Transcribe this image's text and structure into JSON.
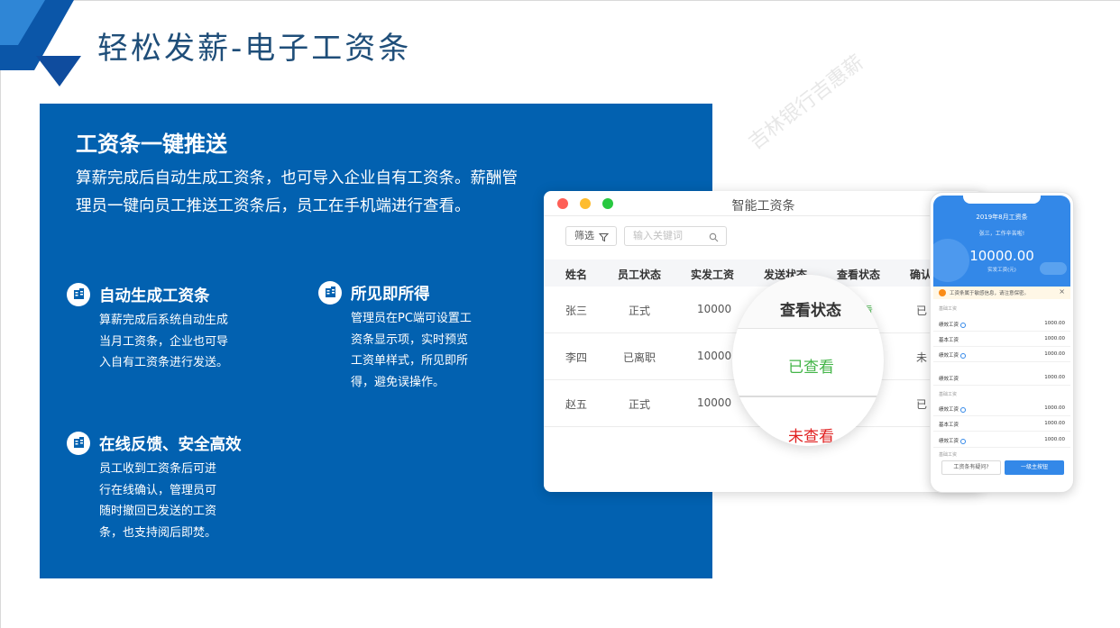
{
  "slide": {
    "title": "轻松发薪-电子工资条"
  },
  "panel": {
    "heading": "工资条一键推送",
    "description": "算薪完成后自动生成工资条，也可导入企业自有工资条。薪酬管理员一键向员工推送工资条后，员工在手机端进行查看。",
    "features": [
      {
        "title": "自动生成工资条",
        "desc": "算薪完成后系统自动生成当月工资条，企业也可导入自有工资条进行发送。",
        "icon": "building-icon"
      },
      {
        "title": "所见即所得",
        "desc": "管理员在PC端可设置工资条显示项，实时预览工资单样式，所见即所得，避免误操作。",
        "icon": "building-icon"
      },
      {
        "title": "在线反馈、安全高效",
        "desc": "员工收到工资条后可进行在线确认，管理员可随时撤回已发送的工资条，也支持阅后即焚。",
        "icon": "building-icon"
      }
    ]
  },
  "watermark": "吉林银行吉惠薪",
  "pc": {
    "title": "智能工资条",
    "filter_label": "筛选",
    "search_placeholder": "输入关键词",
    "columns": [
      "姓名",
      "员工状态",
      "实发工资",
      "发送状态",
      "查看状态",
      "确认"
    ],
    "rows": [
      {
        "name": "张三",
        "status": "正式",
        "salary": "10000",
        "view_fragment": "看",
        "confirm_fragment": "已"
      },
      {
        "name": "李四",
        "status": "已离职",
        "salary": "10000",
        "view_fragment": "",
        "confirm_fragment": "未"
      },
      {
        "name": "赵五",
        "status": "正式",
        "salary": "10000",
        "view_fragment": "",
        "confirm_fragment": "已"
      }
    ],
    "zoom": {
      "header": "查看状态",
      "viewed": "已查看",
      "not_viewed": "未查看"
    }
  },
  "mobile": {
    "month_title": "2019年8月工资条",
    "greeting": "张三，工作辛苦啦!",
    "amount": "10000.00",
    "amount_caption": "实发工资(元)",
    "notice": "工资条属于敏感信息，请注意保密。",
    "notice_close": "×",
    "sections": [
      "基础工资",
      "基础工资",
      "基础工资"
    ],
    "items": [
      {
        "label": "绩效工资",
        "info": true,
        "value": "1000.00"
      },
      {
        "label": "基本工资",
        "info": false,
        "value": "1000.00"
      },
      {
        "label": "绩效工资",
        "info": true,
        "value": "1000.00"
      },
      {
        "label": "绩效工资",
        "info": false,
        "value": "1000.00"
      },
      {
        "label": "绩效工资",
        "info": true,
        "value": "1000.00"
      },
      {
        "label": "基本工资",
        "info": false,
        "value": "1000.00"
      },
      {
        "label": "绩效工资",
        "info": true,
        "value": "1000.00"
      }
    ],
    "question_button": "工资条有疑问?",
    "main_button": "一级主按钮"
  },
  "colors": {
    "panel_blue": "#0261b0",
    "title_blue": "#1f4e79",
    "viewed_green": "#44b549",
    "not_viewed_red": "#e02020",
    "mobile_blue": "#3388e8"
  }
}
